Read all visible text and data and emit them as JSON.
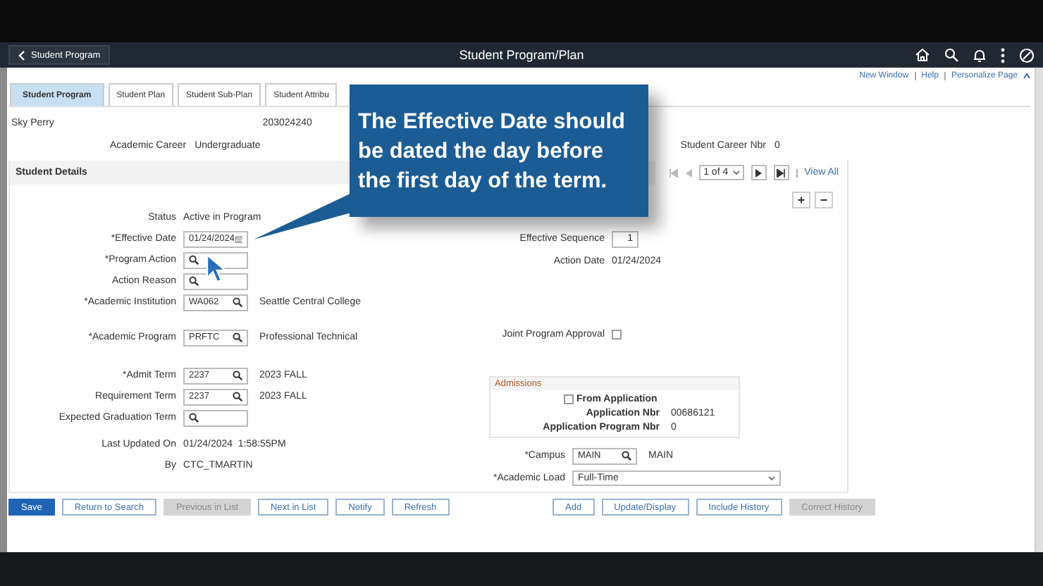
{
  "header": {
    "back_button": "Student Program",
    "title": "Student Program/Plan"
  },
  "links": [
    "New Window",
    "Help",
    "Personalize Page"
  ],
  "tabs": [
    {
      "label": "Student Program",
      "selected": true
    },
    {
      "label": "Student Plan",
      "selected": false
    },
    {
      "label": "Student Sub-Plan",
      "selected": false
    },
    {
      "label": "Student Attribu",
      "selected": false
    }
  ],
  "student": {
    "name": "Sky Perry",
    "id": "203024240",
    "career_label": "Academic Career",
    "career": "Undergraduate",
    "career_nbr_label": "Student Career Nbr",
    "career_nbr": "0"
  },
  "section": {
    "title": "Student Details",
    "pager": "1 of 4",
    "view_all": "View All",
    "add": "+",
    "remove": "−"
  },
  "left_fields": [
    {
      "kind": "display",
      "label": "Status",
      "value": "Active in Program"
    },
    {
      "kind": "date",
      "label": "*Effective Date",
      "value": "01/24/2024"
    },
    {
      "kind": "lookup",
      "label": "*Program Action"
    },
    {
      "kind": "lookup",
      "label": "Action Reason"
    },
    {
      "kind": "lookup",
      "label": "*Academic Institution",
      "value": "WA062",
      "description": "Seattle Central College"
    },
    {
      "kind": "lookup",
      "label": "*Academic Program",
      "value": "PRFTC",
      "description": "Professional Technical"
    },
    {
      "kind": "lookup",
      "label": "*Admit Term",
      "value": "2237",
      "description": "2023 FALL"
    },
    {
      "kind": "lookup",
      "label": "Requirement Term",
      "value": "2237",
      "description": "2023 FALL"
    },
    {
      "kind": "lookup",
      "label": "Expected Graduation Term"
    },
    {
      "kind": "display",
      "label": "Last Updated On",
      "value": "01/24/2024  1:58:55PM"
    },
    {
      "kind": "display",
      "label": "By",
      "value": "CTC_TMARTIN"
    }
  ],
  "right_fields": [
    {
      "kind": "sequence",
      "label": "Effective Sequence",
      "value": "1"
    },
    {
      "kind": "display",
      "label": "Action Date",
      "value": "01/24/2024"
    },
    {
      "kind": "checkbox",
      "label": "Joint Program Approval",
      "checked": false
    },
    {
      "kind": "admissions",
      "title": "Admissions",
      "from_application": {
        "label": "From Application",
        "checked": false
      },
      "rows": [
        {
          "label": "Application Nbr",
          "value": "00686121"
        },
        {
          "label": "Application Program Nbr",
          "value": "0"
        }
      ]
    },
    {
      "kind": "lookup",
      "label": "*Campus",
      "value": "MAIN",
      "description": "MAIN"
    },
    {
      "kind": "select",
      "label": "*Academic Load",
      "value": "Full-Time"
    }
  ],
  "buttons_left": [
    {
      "label": "Save",
      "kind": "primary",
      "disabled": false
    },
    {
      "label": "Return to Search",
      "kind": "normal",
      "disabled": false
    },
    {
      "label": "Previous in List",
      "kind": "normal",
      "disabled": true
    },
    {
      "label": "Next in List",
      "kind": "normal",
      "disabled": false
    },
    {
      "label": "Notify",
      "kind": "normal",
      "disabled": false
    },
    {
      "label": "Refresh",
      "kind": "normal",
      "disabled": false
    }
  ],
  "buttons_right": [
    {
      "label": "Add",
      "kind": "normal",
      "disabled": false
    },
    {
      "label": "Update/Display",
      "kind": "normal",
      "disabled": false
    },
    {
      "label": "Include History",
      "kind": "normal",
      "disabled": false
    },
    {
      "label": "Correct History",
      "kind": "normal",
      "disabled": true
    }
  ],
  "callout": {
    "text": "The Effective Date should be dated the day before the first day of the term."
  }
}
